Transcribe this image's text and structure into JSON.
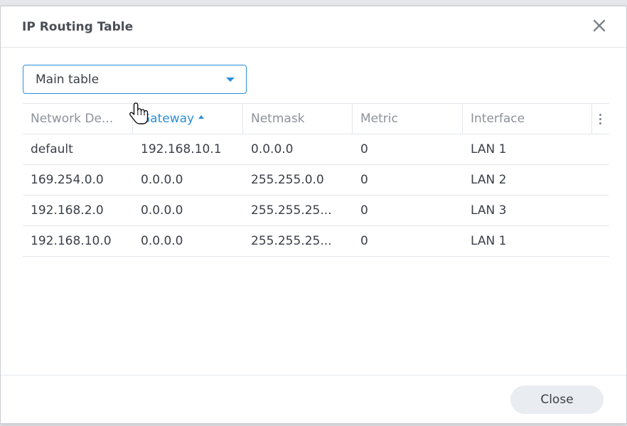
{
  "dialog": {
    "title": "IP Routing Table",
    "close_icon": "close-icon"
  },
  "table_select": {
    "value": "Main table",
    "caret_icon": "caret-down-icon"
  },
  "grid": {
    "columns": [
      "Network De...",
      "Gateway",
      "Netmask",
      "Metric",
      "Interface"
    ],
    "sorted_column": "Gateway",
    "sort_direction": "ascending",
    "menu_icon": "more-vertical-icon",
    "rows": [
      [
        "default",
        "192.168.10.1",
        "0.0.0.0",
        "0",
        "LAN 1"
      ],
      [
        "169.254.0.0",
        "0.0.0.0",
        "255.255.0.0",
        "0",
        "LAN 2"
      ],
      [
        "192.168.2.0",
        "0.0.0.0",
        "255.255.25...",
        "0",
        "LAN 3"
      ],
      [
        "192.168.10.0",
        "0.0.0.0",
        "255.255.25...",
        "0",
        "LAN 1"
      ]
    ]
  },
  "footer": {
    "close_label": "Close"
  },
  "colors": {
    "accent": "#2d8fd8",
    "text": "#3a3f47",
    "header_text": "#8c929b"
  }
}
